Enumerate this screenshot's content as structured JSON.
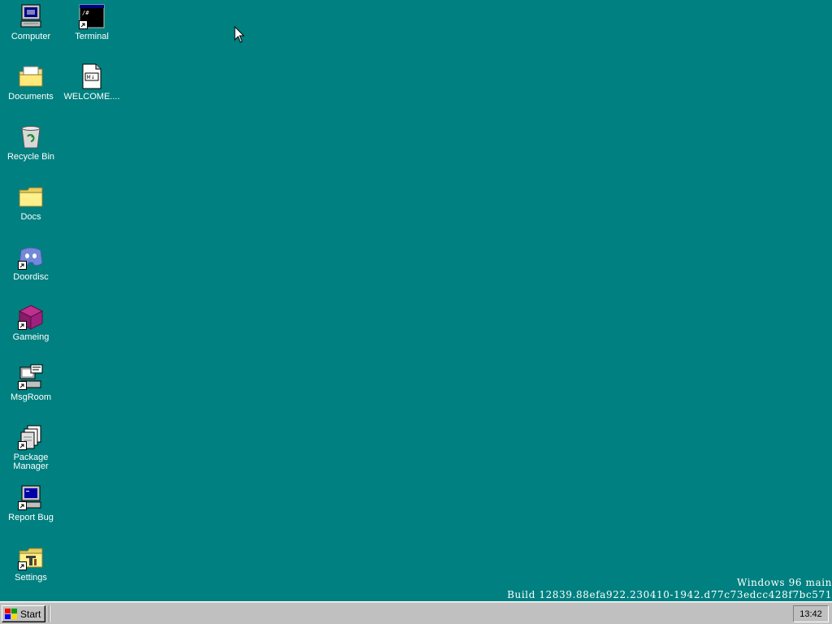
{
  "desktop": {
    "background_color": "#008080",
    "icons": [
      {
        "label": "Computer",
        "icon": "computer-icon",
        "shortcut": false
      },
      {
        "label": "Terminal",
        "icon": "terminal-icon",
        "shortcut": true
      },
      {
        "label": "Documents",
        "icon": "documents-folder-icon",
        "shortcut": false
      },
      {
        "label": "WELCOME....",
        "icon": "markdown-file-icon",
        "shortcut": false
      },
      {
        "label": "Recycle Bin",
        "icon": "recycle-bin-icon",
        "shortcut": false
      },
      {
        "label": "Docs",
        "icon": "folder-icon",
        "shortcut": false
      },
      {
        "label": "Doordisc",
        "icon": "doordisc-icon",
        "shortcut": true
      },
      {
        "label": "Gameing",
        "icon": "game-cube-icon",
        "shortcut": true
      },
      {
        "label": "MsgRoom",
        "icon": "msgroom-icon",
        "shortcut": true
      },
      {
        "label": "Package\nManager",
        "icon": "package-manager-icon",
        "shortcut": true
      },
      {
        "label": "Report Bug",
        "icon": "report-bug-icon",
        "shortcut": true
      },
      {
        "label": "Settings",
        "icon": "settings-icon",
        "shortcut": true
      }
    ],
    "watermark": {
      "line1": "Windows 96 main",
      "line2": "Build 12839.88efa922.230410-1942.d77c73edcc428f7bc571"
    }
  },
  "taskbar": {
    "start_label": "Start",
    "clock": "13:42"
  }
}
